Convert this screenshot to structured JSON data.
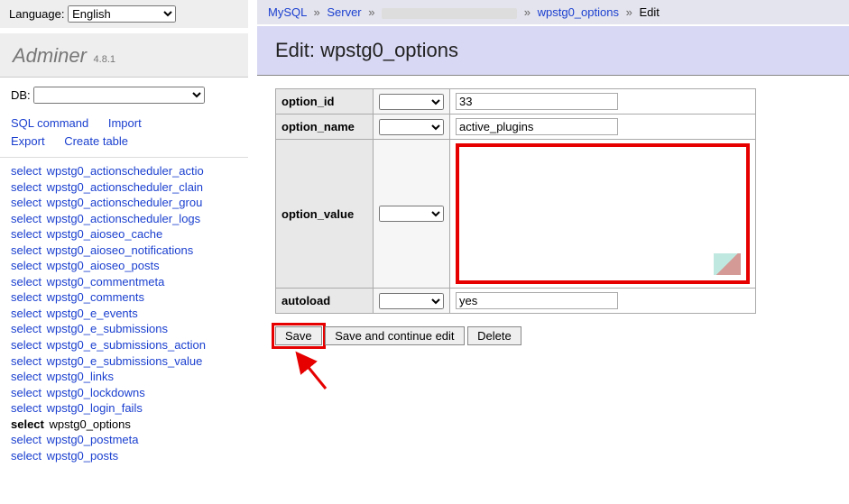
{
  "lang": {
    "label": "Language:",
    "value": "English"
  },
  "brand": {
    "name": "Adminer",
    "version": "4.8.1"
  },
  "db": {
    "label": "DB:",
    "selected": ""
  },
  "side_links": {
    "sql": "SQL command",
    "import": "Import",
    "export": "Export",
    "create": "Create table"
  },
  "tables": {
    "select_word": "select",
    "current": "wpstg0_options",
    "items": [
      "wpstg0_actionscheduler_actio",
      "wpstg0_actionscheduler_clain",
      "wpstg0_actionscheduler_grou",
      "wpstg0_actionscheduler_logs",
      "wpstg0_aioseo_cache",
      "wpstg0_aioseo_notifications",
      "wpstg0_aioseo_posts",
      "wpstg0_commentmeta",
      "wpstg0_comments",
      "wpstg0_e_events",
      "wpstg0_e_submissions",
      "wpstg0_e_submissions_action",
      "wpstg0_e_submissions_value",
      "wpstg0_links",
      "wpstg0_lockdowns",
      "wpstg0_login_fails",
      "wpstg0_options",
      "wpstg0_postmeta",
      "wpstg0_posts"
    ]
  },
  "breadcrumb": {
    "mysql": "MySQL",
    "server": "Server",
    "table": "wpstg0_options",
    "edit": "Edit"
  },
  "heading": "Edit: wpstg0_options",
  "fields": {
    "option_id": {
      "label": "option_id",
      "value": "33"
    },
    "option_name": {
      "label": "option_name",
      "value": "active_plugins"
    },
    "option_value": {
      "label": "option_value",
      "value": ""
    },
    "autoload": {
      "label": "autoload",
      "value": "yes"
    }
  },
  "buttons": {
    "save": "Save",
    "save_continue": "Save and continue edit",
    "delete": "Delete"
  }
}
